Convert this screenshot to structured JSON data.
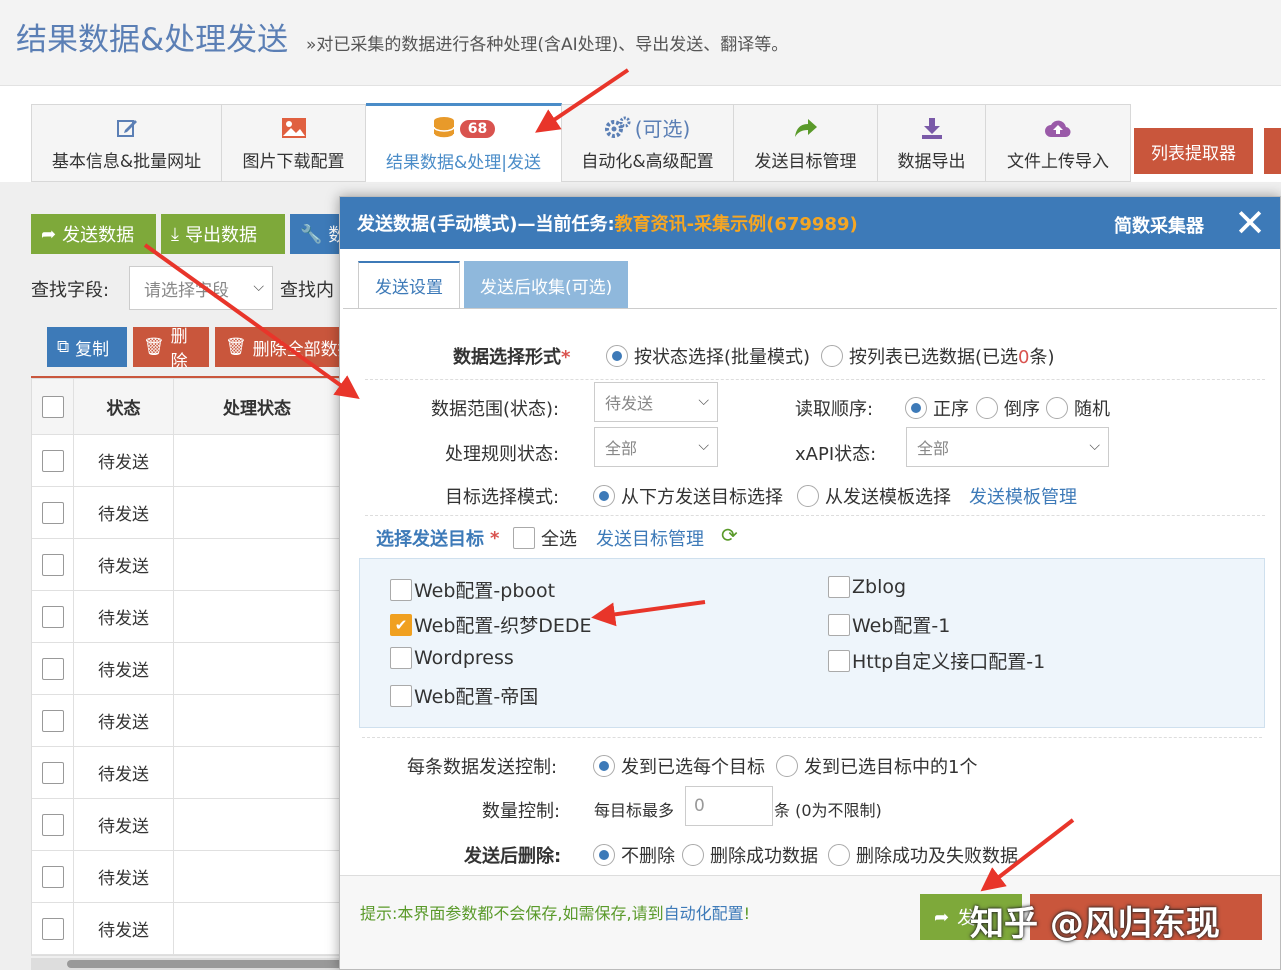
{
  "header": {
    "title": "结果数据&处理发送",
    "subtitle": "»对已采集的数据进行各种处理(含AI处理)、导出发送、翻译等。"
  },
  "tabs": [
    {
      "label": "基本信息&批量网址",
      "icon": "edit-icon"
    },
    {
      "label": "图片下载配置",
      "icon": "image-icon"
    },
    {
      "label": "结果数据&处理|发送",
      "icon": "database-icon",
      "badge": "68",
      "active": true
    },
    {
      "label": "自动化&高级配置",
      "icon": "gears-icon",
      "icon_text": "(可选)"
    },
    {
      "label": "发送目标管理",
      "icon": "share-icon"
    },
    {
      "label": "数据导出",
      "icon": "download-icon"
    },
    {
      "label": "文件上传导入",
      "icon": "cloud-upload-icon"
    }
  ],
  "extract_button": "列表提取器",
  "toolbar": {
    "send_data": "发送数据",
    "export_data": "导出数据",
    "more": "数",
    "find_field_label": "查找字段:",
    "find_field_placeholder": "请选择字段",
    "find_content_label": "查找内",
    "copy": "复制",
    "delete": "删除",
    "delete_all": "删除全部数据"
  },
  "table": {
    "columns": [
      "状态",
      "处理状态"
    ],
    "rows": [
      "待发送",
      "待发送",
      "待发送",
      "待发送",
      "待发送",
      "待发送",
      "待发送",
      "待发送",
      "待发送",
      "待发送"
    ]
  },
  "dialog": {
    "title_prefix": "发送数据(手动模式)—当前任务: ",
    "task": "教育资讯-采集示例(679989)",
    "brand": "简数采集器",
    "close": "✕",
    "tabs": [
      "发送设置",
      "发送后收集(可选)"
    ],
    "select_mode_label": "数据选择形式",
    "select_mode_opt1": "按状态选择(批量模式)",
    "select_mode_opt2_prefix": "按列表已选数据(已选",
    "select_mode_opt2_count": "0",
    "select_mode_opt2_suffix": "条)",
    "range_label": "数据范围(状态):",
    "range_value": "待发送",
    "order_label": "读取顺序:",
    "order_opts": [
      "正序",
      "倒序",
      "随机"
    ],
    "rule_label": "处理规则状态:",
    "rule_value": "全部",
    "xapi_label": "xAPI状态:",
    "xapi_value": "全部",
    "target_mode_label": "目标选择模式:",
    "target_mode_opt1": "从下方发送目标选择",
    "target_mode_opt2": "从发送模板选择",
    "template_link": "发送模板管理",
    "choose_target_label": "选择发送目标",
    "select_all": "全选",
    "target_manage_link": "发送目标管理",
    "targets_left": [
      "Web配置-pboot",
      "Web配置-织梦DEDE",
      "Wordpress",
      "Web配置-帝国"
    ],
    "targets_right": [
      "Zblog",
      "Web配置-1",
      "Http自定义接口配置-1"
    ],
    "per_data_label": "每条数据发送控制:",
    "per_data_opt1": "发到已选每个目标",
    "per_data_opt2": "发到已选目标中的1个",
    "qty_label": "数量控制:",
    "qty_prefix": "每目标最多",
    "qty_value": "0",
    "qty_suffix": "条 (0为不限制)",
    "after_delete_label": "发送后删除:",
    "after_delete_opts": [
      "不删除",
      "删除成功数据",
      "删除成功及失败数据"
    ],
    "hint_prefix": "提示:本界面参数都不会保存,如需保存,请到",
    "hint_link": "自动化配置",
    "hint_suffix": "!",
    "send_button": "发",
    "watermark": "知乎 @风归东现"
  }
}
